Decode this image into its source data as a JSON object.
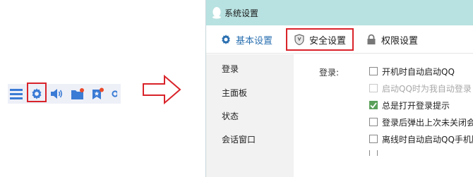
{
  "toolbar": {
    "icons": [
      "menu-icon",
      "gear-icon",
      "speaker-icon",
      "folder-icon",
      "bookmark-icon",
      "more-icon"
    ],
    "colors": {
      "accent": "#3a7bd5",
      "badge": "#e94b2b",
      "highlight": "#d9232a"
    }
  },
  "window": {
    "title": "系统设置",
    "tabs": [
      {
        "label": "基本设置",
        "icon": "gear-icon"
      },
      {
        "label": "安全设置",
        "icon": "shield-icon"
      },
      {
        "label": "权限设置",
        "icon": "lock-icon"
      }
    ],
    "sidebar": [
      "登录",
      "主面板",
      "状态",
      "会话窗口"
    ],
    "login_label": "登录:",
    "options": [
      {
        "label": "开机时自动启动QQ",
        "checked": false,
        "disabled": false
      },
      {
        "label": "启动QQ时为我自动登录",
        "checked": false,
        "disabled": true
      },
      {
        "label": "总是打开登录提示",
        "checked": true,
        "disabled": false
      },
      {
        "label": "登录后弹出上次未关闭会",
        "checked": false,
        "disabled": false
      },
      {
        "label": "离线时自动启动QQ手机版",
        "checked": false,
        "disabled": false
      }
    ]
  }
}
